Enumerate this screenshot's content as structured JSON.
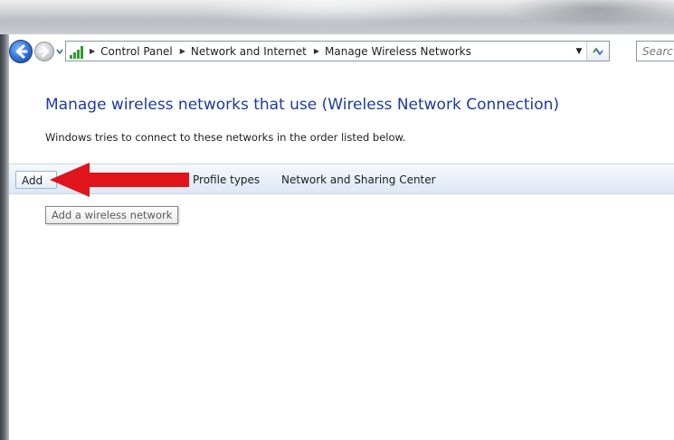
{
  "breadcrumb": [
    "Control Panel",
    "Network and Internet",
    "Manage Wireless Networks"
  ],
  "search": {
    "placeholder": "Search Control Panel",
    "visible_text": "Searc"
  },
  "page": {
    "title": "Manage wireless networks that use (Wireless Network Connection)",
    "description": "Windows tries to connect to these networks in the order listed below."
  },
  "toolbar": {
    "add_label": "Add",
    "profile_types_label": "Profile types",
    "network_sharing_label": "Network and Sharing Center"
  },
  "tooltip": {
    "text": "Add a wireless network"
  },
  "icons": {
    "back": "back-arrow-icon",
    "forward": "forward-arrow-icon",
    "network": "wireless-network-icon",
    "refresh": "refresh-icon",
    "annotation": "red-arrow-annotation"
  },
  "colors": {
    "title": "#1c3c9e",
    "annotation_arrow": "#e0141b",
    "toolbar_bg": "#e9f0f8"
  }
}
